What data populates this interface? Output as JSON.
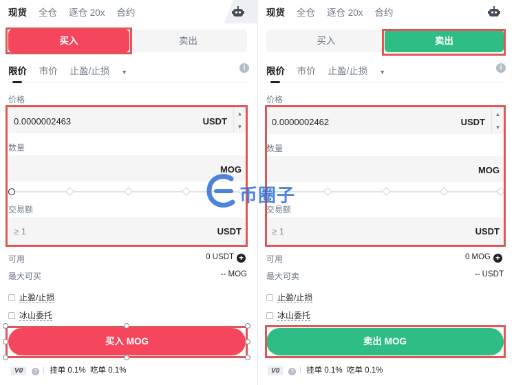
{
  "tabs": [
    "现货",
    "全仓",
    "逐仓 20x",
    "合约"
  ],
  "buy_panel": {
    "side_buttons": {
      "buy": "买入",
      "sell": "卖出"
    },
    "order_types": {
      "limit": "限价",
      "market": "市价",
      "stop": "止盈/止损"
    },
    "price_label": "价格",
    "price_value": "0.0000002463",
    "price_unit": "USDT",
    "amount_label": "数量",
    "amount_unit": "MOG",
    "total_label": "交易额",
    "total_placeholder": "≥ 1",
    "total_unit": "USDT",
    "available_label": "可用",
    "available_value": "0 USDT",
    "max_label": "最大可买",
    "max_value": "-- MOG",
    "tpsl_label": "止盈/止损",
    "iceberg_label": "冰山委托",
    "action_label": "买入 MOG",
    "vip": "V0",
    "maker_fee": "挂单 0.1%",
    "taker_fee": "吃单 0.1%"
  },
  "sell_panel": {
    "side_buttons": {
      "buy": "买入",
      "sell": "卖出"
    },
    "order_types": {
      "limit": "限价",
      "market": "市价",
      "stop": "止盈/止损"
    },
    "price_label": "价格",
    "price_value": "0.0000002462",
    "price_unit": "USDT",
    "amount_label": "数量",
    "amount_unit": "MOG",
    "total_label": "交易额",
    "total_placeholder": "≥ 1",
    "total_unit": "USDT",
    "available_label": "可用",
    "available_value": "0 MOG",
    "max_label": "最大可卖",
    "max_value": "-- USDT",
    "tpsl_label": "止盈/止损",
    "iceberg_label": "冰山委托",
    "action_label": "卖出 MOG",
    "vip": "V0",
    "maker_fee": "挂单 0.1%",
    "taker_fee": "吃单 0.1%"
  },
  "watermark": "币圈子",
  "colors": {
    "buy": "#f6465d",
    "sell": "#2ebd85",
    "highlight": "#e05555"
  }
}
